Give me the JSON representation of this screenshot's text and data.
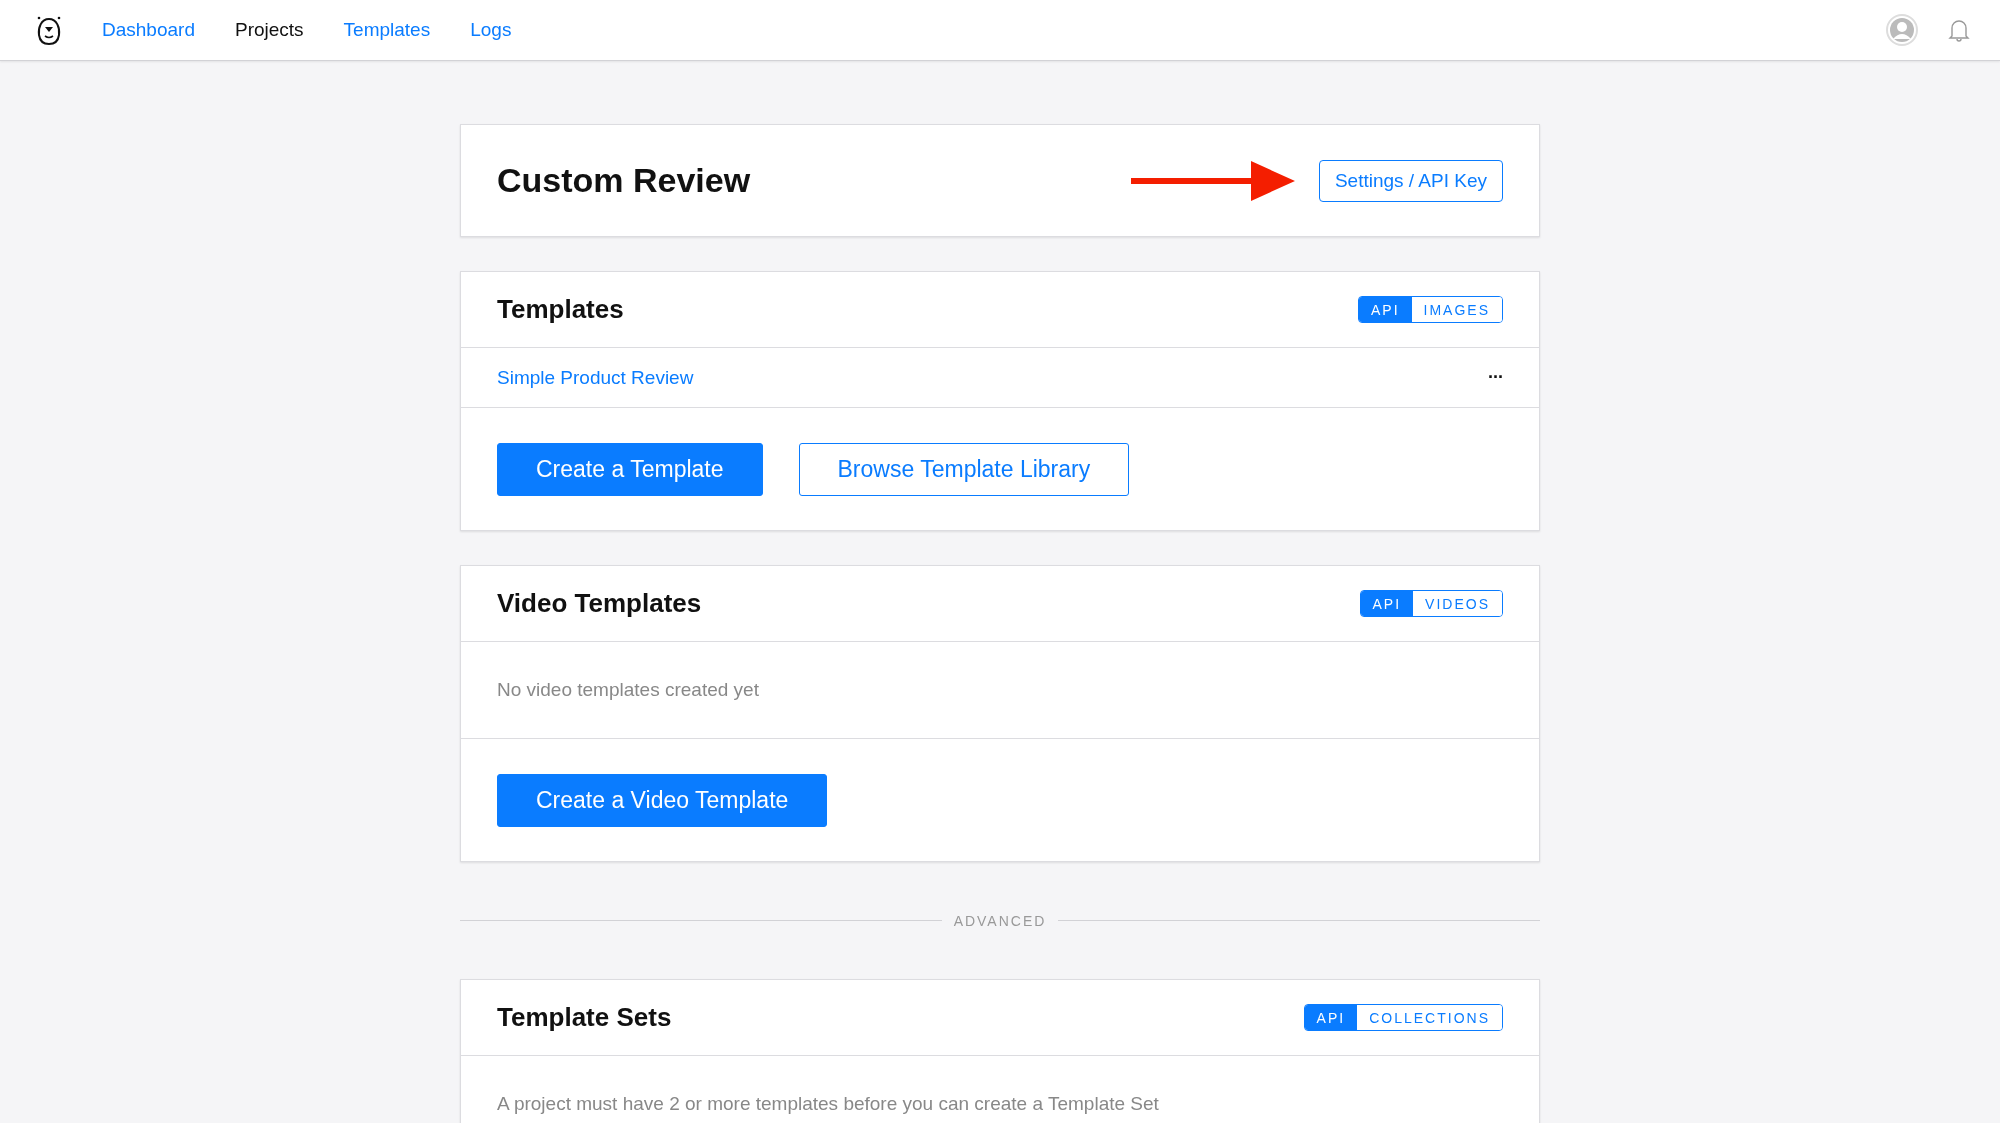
{
  "nav": {
    "links": [
      {
        "label": "Dashboard",
        "selected": false
      },
      {
        "label": "Projects",
        "selected": true
      },
      {
        "label": "Templates",
        "selected": false
      },
      {
        "label": "Logs",
        "selected": false
      }
    ]
  },
  "header": {
    "title": "Custom Review",
    "button": "Settings / API Key"
  },
  "sections": [
    {
      "kind": "card",
      "title": "Templates",
      "tags": [
        {
          "label": "API",
          "selected": true
        },
        {
          "label": "IMAGES",
          "selected": false
        }
      ],
      "rows": [
        {
          "kind": "item",
          "label": "Simple Product Review",
          "menu": "···"
        },
        {
          "kind": "buttons",
          "buttons": [
            {
              "label": "Create a Template",
              "kind": "primary"
            },
            {
              "label": "Browse Template Library",
              "kind": "outline"
            }
          ]
        }
      ]
    },
    {
      "kind": "card",
      "title": "Video Templates",
      "tags": [
        {
          "label": "API",
          "selected": true
        },
        {
          "label": "VIDEOS",
          "selected": false
        }
      ],
      "rows": [
        {
          "kind": "message",
          "text": "No video templates created yet"
        },
        {
          "kind": "buttons",
          "buttons": [
            {
              "label": "Create a Video Template",
              "kind": "primary"
            }
          ]
        }
      ]
    },
    {
      "kind": "divider",
      "label": "ADVANCED"
    },
    {
      "kind": "card",
      "title": "Template Sets",
      "tags": [
        {
          "label": "API",
          "selected": true
        },
        {
          "label": "COLLECTIONS",
          "selected": false
        }
      ],
      "rows": [
        {
          "kind": "message",
          "text": "A project must have 2 or more templates before you can create a Template Set"
        }
      ]
    }
  ]
}
